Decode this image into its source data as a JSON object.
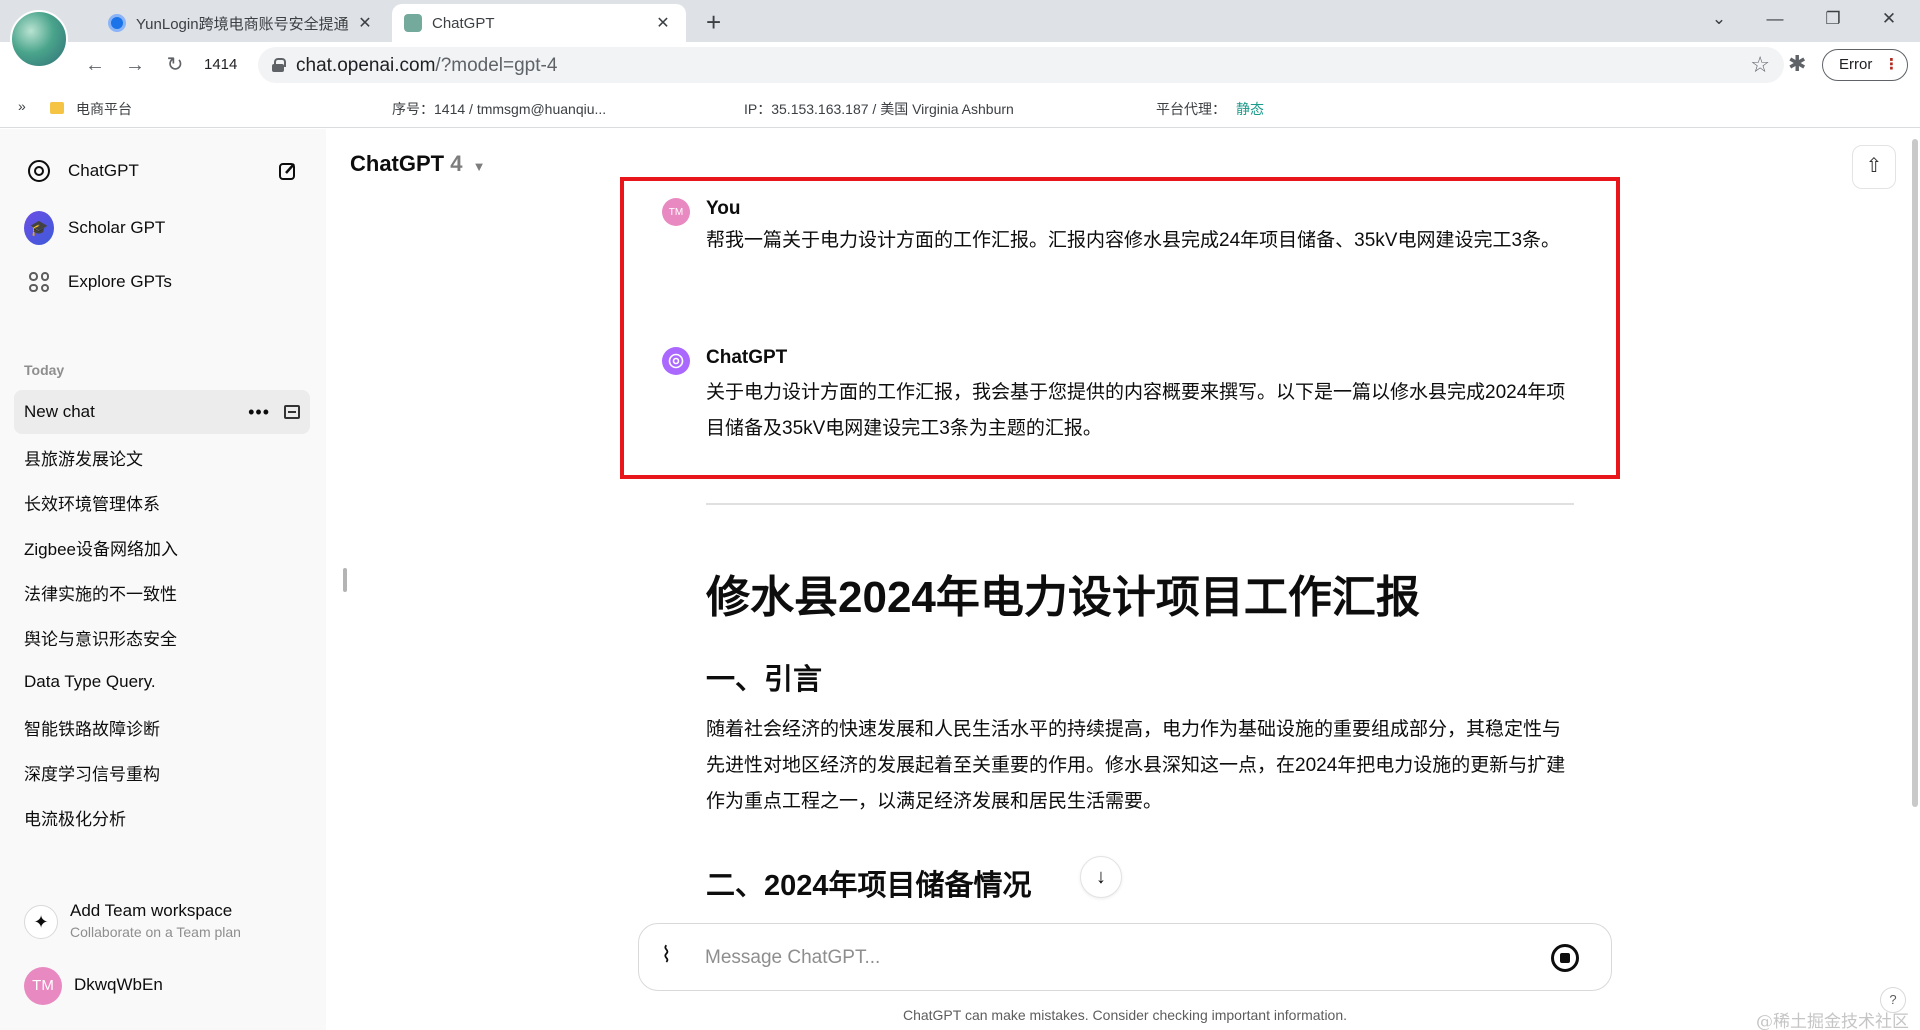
{
  "browser": {
    "tabs": [
      {
        "title": "YunLogin跨境电商账号安全提通",
        "active": false
      },
      {
        "title": "ChatGPT",
        "active": true
      }
    ],
    "tab_count": "1414",
    "url_host": "chat.openai.com",
    "url_path": "/?model=gpt-4",
    "error_button": "Error"
  },
  "bookmarks": {
    "folder": "电商平台",
    "serial": "序号：1414 / tmmsgm@huanqiu...",
    "ip": "IP：35.153.163.187 / 美国 Virginia Ashburn",
    "proxy_label": "平台代理：",
    "proxy_value": "静态"
  },
  "sidebar": {
    "app_name": "ChatGPT",
    "gpts": [
      {
        "label": "Scholar GPT",
        "icon": "scholar-icon"
      },
      {
        "label": "Explore GPTs",
        "icon": "explore-grid-icon"
      }
    ],
    "section_today": "Today",
    "chats": [
      {
        "label": "New chat",
        "active": true
      },
      {
        "label": "县旅游发展论文"
      },
      {
        "label": "长效环境管理体系"
      },
      {
        "label": "Zigbee设备网络加入"
      },
      {
        "label": "法律实施的不一致性"
      },
      {
        "label": "舆论与意识形态安全"
      },
      {
        "label": "Data Type Query."
      },
      {
        "label": "智能铁路故障诊断"
      },
      {
        "label": "深度学习信号重构"
      },
      {
        "label": "电流极化分析"
      }
    ],
    "chat_more": "•••",
    "team": {
      "title": "Add Team workspace",
      "subtitle": "Collaborate on a Team plan"
    },
    "user": {
      "initials": "TM",
      "name": "DkwqWbEn"
    }
  },
  "main": {
    "model_name": "ChatGPT",
    "model_version": "4",
    "messages": [
      {
        "author": "You",
        "avatar": "TM",
        "text": "帮我一篇关于电力设计方面的工作汇报。汇报内容修水县完成24年项目储备、35kV电网建设完工3条。"
      },
      {
        "author": "ChatGPT",
        "text": "关于电力设计方面的工作汇报，我会基于您提供的内容概要来撰写。以下是一篇以修水县完成2024年项目储备及35kV电网建设完工3条为主题的汇报。"
      }
    ],
    "doc": {
      "title": "修水县2024年电力设计项目工作汇报",
      "section1": "一、引言",
      "intro": "随着社会经济的快速发展和人民生活水平的持续提高，电力作为基础设施的重要组成部分，其稳定性与先进性对地区经济的发展起着至关重要的作用。修水县深知这一点，在2024年把电力设施的更新与扩建作为重点工程之一，以满足经济发展和居民生活需要。",
      "section2": "二、2024年项目储备情况"
    },
    "composer_placeholder": "Message ChatGPT...",
    "disclaimer": "ChatGPT can make mistakes. Consider checking important information.",
    "help": "?",
    "highlight_color": "#e8151b",
    "watermark": "@稀土掘金技术社区"
  }
}
